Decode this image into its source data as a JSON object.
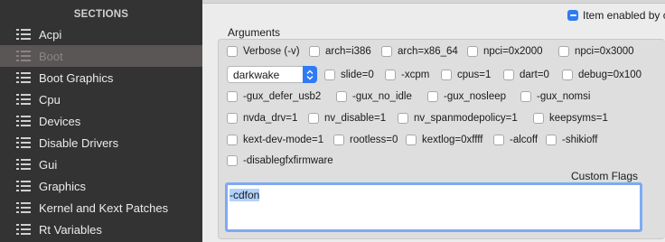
{
  "sidebar": {
    "header": "SECTIONS",
    "items": [
      {
        "label": "Acpi"
      },
      {
        "label": "Boot"
      },
      {
        "label": "Boot Graphics"
      },
      {
        "label": "Cpu"
      },
      {
        "label": "Devices"
      },
      {
        "label": "Disable Drivers"
      },
      {
        "label": "Gui"
      },
      {
        "label": "Graphics"
      },
      {
        "label": "Kernel and Kext Patches"
      },
      {
        "label": "Rt Variables"
      }
    ],
    "selected": "Boot"
  },
  "enabled": {
    "label": "Item enabled by c",
    "checked": true
  },
  "arguments": {
    "title": "Arguments",
    "dropdown": {
      "value": "darkwake"
    },
    "options": [
      {
        "label": "Verbose (-v)"
      },
      {
        "label": "arch=i386"
      },
      {
        "label": "arch=x86_64"
      },
      {
        "label": "npci=0x2000"
      },
      {
        "label": "npci=0x3000"
      },
      {
        "label": "slide=0"
      },
      {
        "label": "-xcpm"
      },
      {
        "label": "cpus=1"
      },
      {
        "label": "dart=0"
      },
      {
        "label": "debug=0x100"
      },
      {
        "label": "-gux_defer_usb2"
      },
      {
        "label": "-gux_no_idle"
      },
      {
        "label": "-gux_nosleep"
      },
      {
        "label": "-gux_nomsi"
      },
      {
        "label": "nvda_drv=1"
      },
      {
        "label": "nv_disable=1"
      },
      {
        "label": "nv_spanmodepolicy=1"
      },
      {
        "label": "keepsyms=1"
      },
      {
        "label": "kext-dev-mode=1"
      },
      {
        "label": "rootless=0"
      },
      {
        "label": "kextlog=0xffff"
      },
      {
        "label": "-alcoff"
      },
      {
        "label": "-shikioff"
      },
      {
        "label": "-disablegfxfirmware"
      }
    ],
    "custom_flags_label": "Custom Flags",
    "custom_flags_value": "-cdfon"
  },
  "colors": {
    "sidebar_bg": "#333333",
    "selected_bg": "#5a5655",
    "accent": "#2f7bf5"
  }
}
